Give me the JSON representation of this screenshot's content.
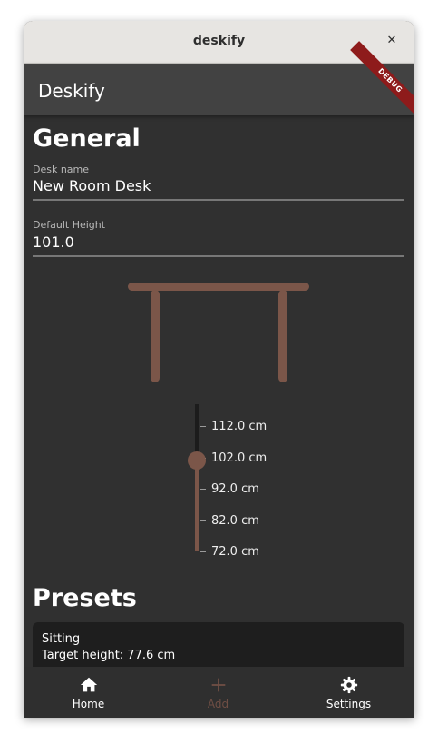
{
  "window": {
    "title": "deskify",
    "close_glyph": "✕"
  },
  "appbar": {
    "title": "Deskify",
    "debug_banner": "DEBUG"
  },
  "general": {
    "heading": "General",
    "desk_name": {
      "label": "Desk name",
      "value": "New Room Desk"
    },
    "default_height": {
      "label": "Default Height",
      "value": "101.0"
    }
  },
  "slider": {
    "value_cm": 102.0,
    "min_cm": 72.0,
    "max_cm": 112.0,
    "ticks": [
      "112.0 cm",
      "102.0 cm",
      "92.0 cm",
      "82.0 cm",
      "72.0 cm"
    ]
  },
  "presets": {
    "heading": "Presets",
    "items": [
      {
        "name": "Sitting",
        "target": "Target height: 77.6 cm"
      }
    ]
  },
  "nav": {
    "items": [
      {
        "label": "Home",
        "icon": "home-icon",
        "active": true
      },
      {
        "label": "Add",
        "icon": "plus-icon",
        "active": false
      },
      {
        "label": "Settings",
        "icon": "gear-icon",
        "active": true
      }
    ]
  },
  "colors": {
    "accent": "#7b5649",
    "background": "#303030",
    "appbar": "#424242",
    "card": "#1e1e1e",
    "nav_active": "#ffffff",
    "nav_inactive": "#6f4e44"
  }
}
